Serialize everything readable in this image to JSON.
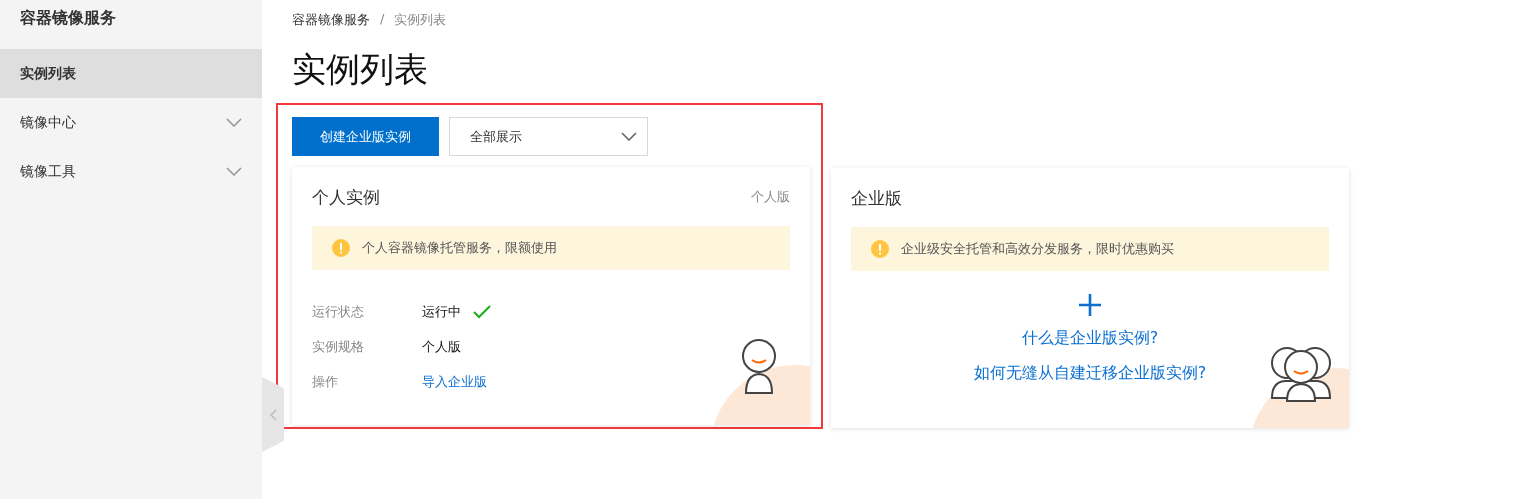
{
  "sidebar": {
    "title": "容器镜像服务",
    "items": [
      {
        "label": "实例列表",
        "kind": "link",
        "selected": true
      },
      {
        "label": "镜像中心",
        "kind": "group",
        "selected": false,
        "expanded": false
      },
      {
        "label": "镜像工具",
        "kind": "group",
        "selected": false,
        "expanded": false
      }
    ]
  },
  "breadcrumb": {
    "items": [
      "容器镜像服务",
      "实例列表"
    ],
    "separator": "/"
  },
  "page_title": "实例列表",
  "toolbar": {
    "create_button": "创建企业版实例",
    "filter": {
      "value": "全部展示"
    }
  },
  "cards": [
    {
      "kind": "personal",
      "title": "个人实例",
      "edition_tag": "个人版",
      "notice": "个人容器镜像托管服务，限额使用",
      "details": [
        {
          "label": "运行状态",
          "value": "运行中",
          "kind": "status",
          "running": true
        },
        {
          "label": "实例规格",
          "value": "个人版",
          "kind": "text"
        },
        {
          "label": "操作",
          "value": "导入企业版",
          "kind": "link"
        }
      ]
    },
    {
      "kind": "enterprise",
      "title": "企业版",
      "notice": "企业级安全托管和高效分发服务，限时优惠购买",
      "links": [
        "什么是企业版实例?",
        "如何无缝从自建迁移企业版实例?"
      ]
    }
  ]
}
